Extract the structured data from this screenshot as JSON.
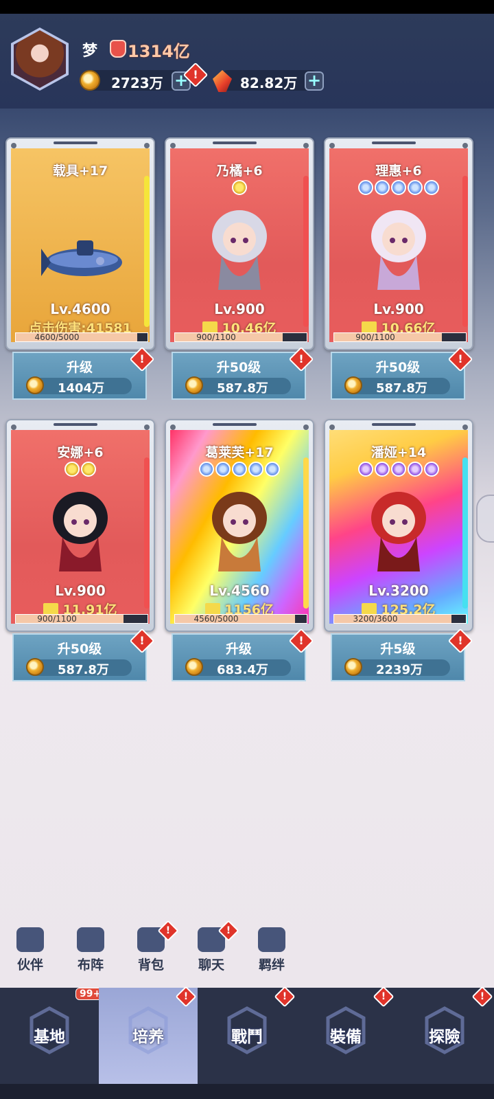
{
  "player": {
    "name": "梦",
    "power": "1314亿",
    "gold": "2723万",
    "gems": "82.82万"
  },
  "colors": {
    "header_bg": "#2d3b5a",
    "alert": "#e0342a",
    "upgrade_btn": "#5b92b4",
    "tabbar": "#2b3248",
    "active_tab": "#aab4e0"
  },
  "cards": [
    {
      "title": "载具+17",
      "stars": 0,
      "star_color": "",
      "level": "Lv.4600",
      "stat": "点击伤害:41581",
      "stat_icon": false,
      "progress": "4600/5000",
      "progress_frac": 0.92,
      "button_label": "升级",
      "cost": "1404万",
      "theme": "gold",
      "has_alert": true
    },
    {
      "title": "乃橘+6",
      "stars": 1,
      "star_color": "gold",
      "level": "Lv.900",
      "stat": "10.46亿",
      "stat_icon": true,
      "progress": "900/1100",
      "progress_frac": 0.818,
      "button_label": "升50级",
      "cost": "587.8万",
      "theme": "red",
      "has_alert": true
    },
    {
      "title": "理惠+6",
      "stars": 5,
      "star_color": "blue",
      "level": "Lv.900",
      "stat": "10.66亿",
      "stat_icon": true,
      "progress": "900/1100",
      "progress_frac": 0.818,
      "button_label": "升50级",
      "cost": "587.8万",
      "theme": "red",
      "has_alert": true
    },
    {
      "title": "安娜+6",
      "stars": 2,
      "star_color": "gold",
      "level": "Lv.900",
      "stat": "11.91亿",
      "stat_icon": true,
      "progress": "900/1100",
      "progress_frac": 0.818,
      "button_label": "升50级",
      "cost": "587.8万",
      "theme": "red",
      "has_alert": true
    },
    {
      "title": "葛莱芙+17",
      "stars": 5,
      "star_color": "blue",
      "level": "Lv.4560",
      "stat": "1156亿",
      "stat_icon": true,
      "progress": "4560/5000",
      "progress_frac": 0.912,
      "button_label": "升级",
      "cost": "683.4万",
      "theme": "rainbow",
      "has_alert": true
    },
    {
      "title": "潘娅+14",
      "stars": 5,
      "star_color": "purple",
      "level": "Lv.3200",
      "stat": "125.2亿",
      "stat_icon": true,
      "progress": "3200/3600",
      "progress_frac": 0.889,
      "button_label": "升5级",
      "cost": "2239万",
      "theme": "rainbow2",
      "has_alert": true
    }
  ],
  "side_nav": [
    {
      "label": "伙伴",
      "icon": "partners-icon",
      "alert": false
    },
    {
      "label": "布阵",
      "icon": "formation-flag-icon",
      "alert": false
    },
    {
      "label": "背包",
      "icon": "backpack-icon",
      "alert": true
    },
    {
      "label": "聊天",
      "icon": "chat-icon",
      "alert": true
    },
    {
      "label": "羁绊",
      "icon": "bond-icon",
      "alert": false
    }
  ],
  "tabs": [
    {
      "label": "基地",
      "badge": "99+",
      "alert": false,
      "active": false,
      "icon": "base-building-icon"
    },
    {
      "label": "培养",
      "badge": "",
      "alert": true,
      "active": true,
      "icon": "train-wing-icon"
    },
    {
      "label": "戰鬥",
      "badge": "",
      "alert": true,
      "active": false,
      "icon": "battle-swords-icon"
    },
    {
      "label": "裝備",
      "badge": "",
      "alert": true,
      "active": false,
      "icon": "equipment-shield-icon"
    },
    {
      "label": "探險",
      "badge": "",
      "alert": true,
      "active": false,
      "icon": "explore-compass-icon"
    }
  ]
}
